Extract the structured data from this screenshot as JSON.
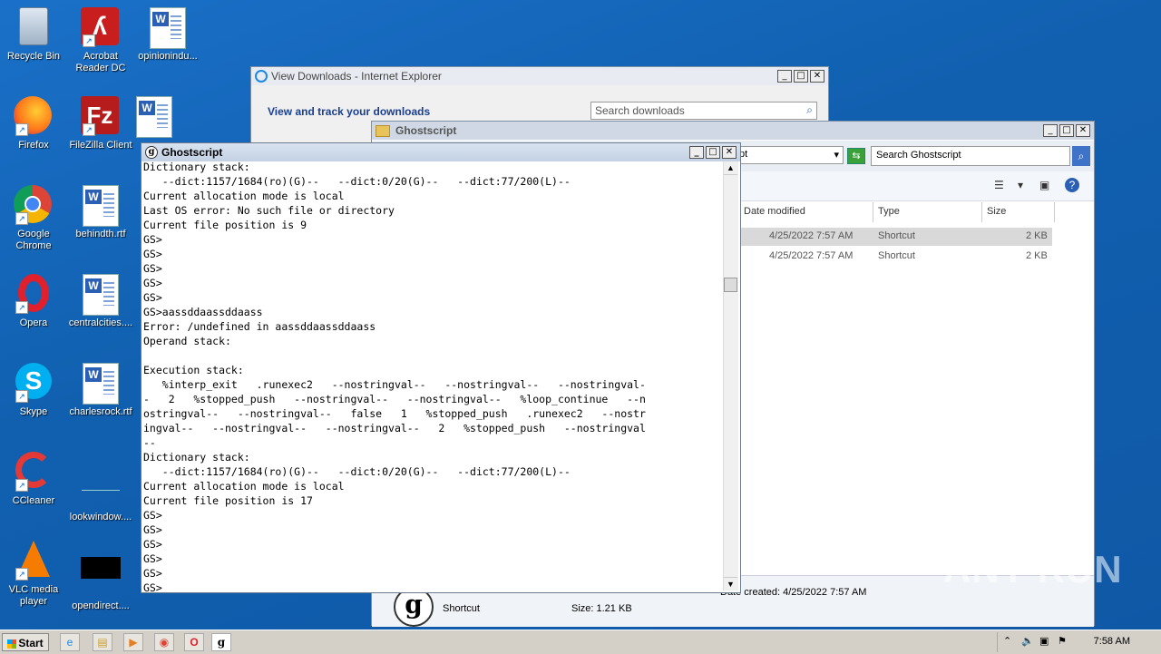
{
  "desktop": {
    "icons": [
      {
        "label": "Recycle Bin"
      },
      {
        "label": "Acrobat Reader DC"
      },
      {
        "label": "opinionindu..."
      },
      {
        "label": "Firefox"
      },
      {
        "label": "FileZilla Client"
      },
      {
        "label": "Google Chrome"
      },
      {
        "label": "behindth.rtf"
      },
      {
        "label": "Opera"
      },
      {
        "label": "centralcities...."
      },
      {
        "label": "Skype"
      },
      {
        "label": "charlesrock.rtf"
      },
      {
        "label": "CCleaner"
      },
      {
        "label": "lookwindow...."
      },
      {
        "label": "VLC media player"
      },
      {
        "label": "opendirect...."
      }
    ]
  },
  "ie": {
    "title": "View Downloads - Internet Explorer",
    "subtitle": "View and track your downloads",
    "search_placeholder": "Search downloads"
  },
  "explorer": {
    "title": "Ghostscript",
    "address_fragment": "pt",
    "search_placeholder": "Search Ghostscript",
    "columns": [
      "Date modified",
      "Type",
      "Size"
    ],
    "rows": [
      {
        "date": "4/25/2022 7:57 AM",
        "type": "Shortcut",
        "size": "2 KB"
      },
      {
        "date": "4/25/2022 7:57 AM",
        "type": "Shortcut",
        "size": "2 KB"
      }
    ],
    "details": {
      "type": "Shortcut",
      "size": "Size: 1.21 KB",
      "created": "Date created: 4/25/2022 7:57 AM"
    }
  },
  "ghostscript": {
    "title": "Ghostscript",
    "console_lines": [
      "Dictionary stack:",
      "   --dict:1157/1684(ro)(G)--   --dict:0/20(G)--   --dict:77/200(L)--",
      "Current allocation mode is local",
      "Last OS error: No such file or directory",
      "Current file position is 9",
      "GS>",
      "GS>",
      "GS>",
      "GS>",
      "GS>",
      "GS>aassddaassddaass",
      "Error: /undefined in aassddaassddaass",
      "Operand stack:",
      "",
      "Execution stack:",
      "   %interp_exit   .runexec2   --nostringval--   --nostringval--   --nostringval-",
      "-   2   %stopped_push   --nostringval--   --nostringval--   %loop_continue   --n",
      "ostringval--   --nostringval--   false   1   %stopped_push   .runexec2   --nostr",
      "ingval--   --nostringval--   --nostringval--   2   %stopped_push   --nostringval",
      "--",
      "Dictionary stack:",
      "   --dict:1157/1684(ro)(G)--   --dict:0/20(G)--   --dict:77/200(L)--",
      "Current allocation mode is local",
      "Current file position is 17",
      "GS>",
      "GS>",
      "GS>",
      "GS>",
      "GS>",
      "GS>"
    ]
  },
  "taskbar": {
    "start_label": "Start",
    "clock": "7:58 AM"
  },
  "watermark": "ANY RUN"
}
